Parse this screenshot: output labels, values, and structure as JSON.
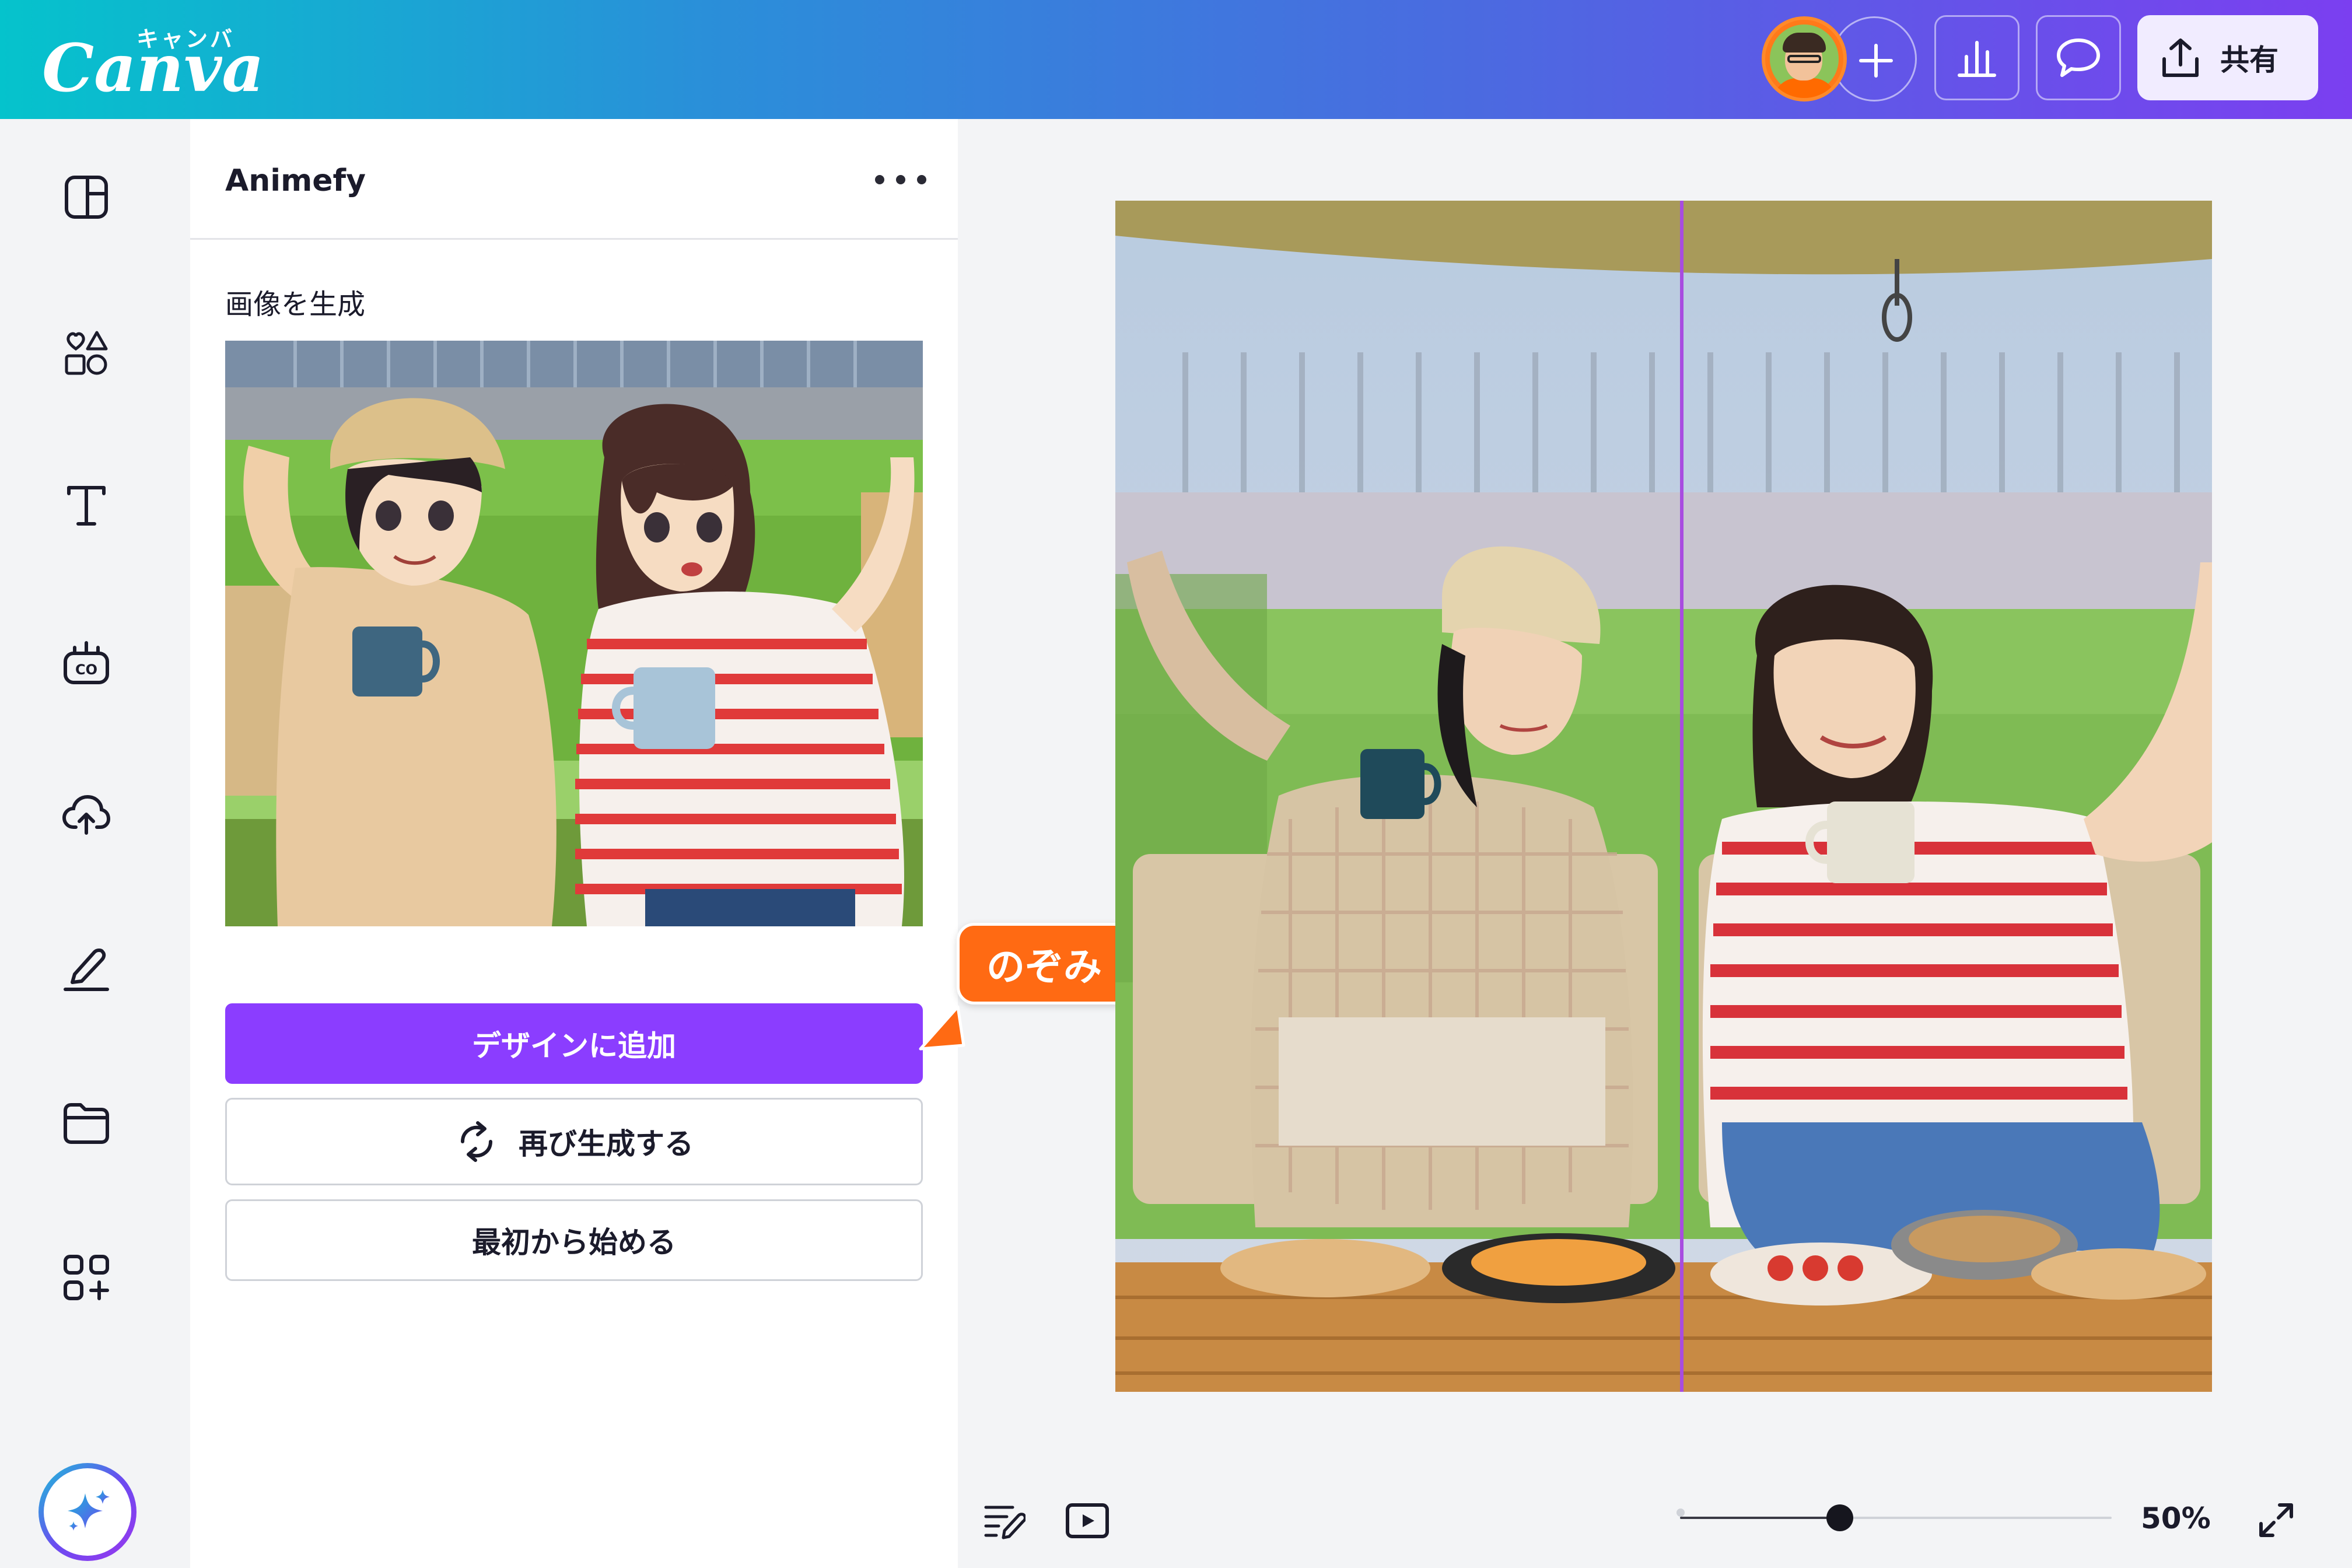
{
  "header": {
    "logo_kana": "キャンバ",
    "logo_text": "Canva",
    "share_label": "共有",
    "accent_start": "#05c3cc",
    "accent_end": "#7b3ff0"
  },
  "sidebar": {
    "items": [
      {
        "icon": "layout-icon"
      },
      {
        "icon": "elements-icon"
      },
      {
        "icon": "text-icon"
      },
      {
        "icon": "brand-icon"
      },
      {
        "icon": "uploads-icon"
      },
      {
        "icon": "draw-icon"
      },
      {
        "icon": "projects-icon"
      },
      {
        "icon": "apps-icon"
      }
    ],
    "magic_icon": "sparkle-icon"
  },
  "panel": {
    "title": "Animefy",
    "subhead": "画像を生成",
    "add_to_design": "デザインに追加",
    "regenerate": "再び生成する",
    "start_over": "最初から始める",
    "primary_color": "#8b3dff"
  },
  "collaborator": {
    "name": "のぞみ",
    "color": "#ff6a13"
  },
  "bottom_bar": {
    "zoom_label": "50%",
    "zoom_value": 0.5
  }
}
